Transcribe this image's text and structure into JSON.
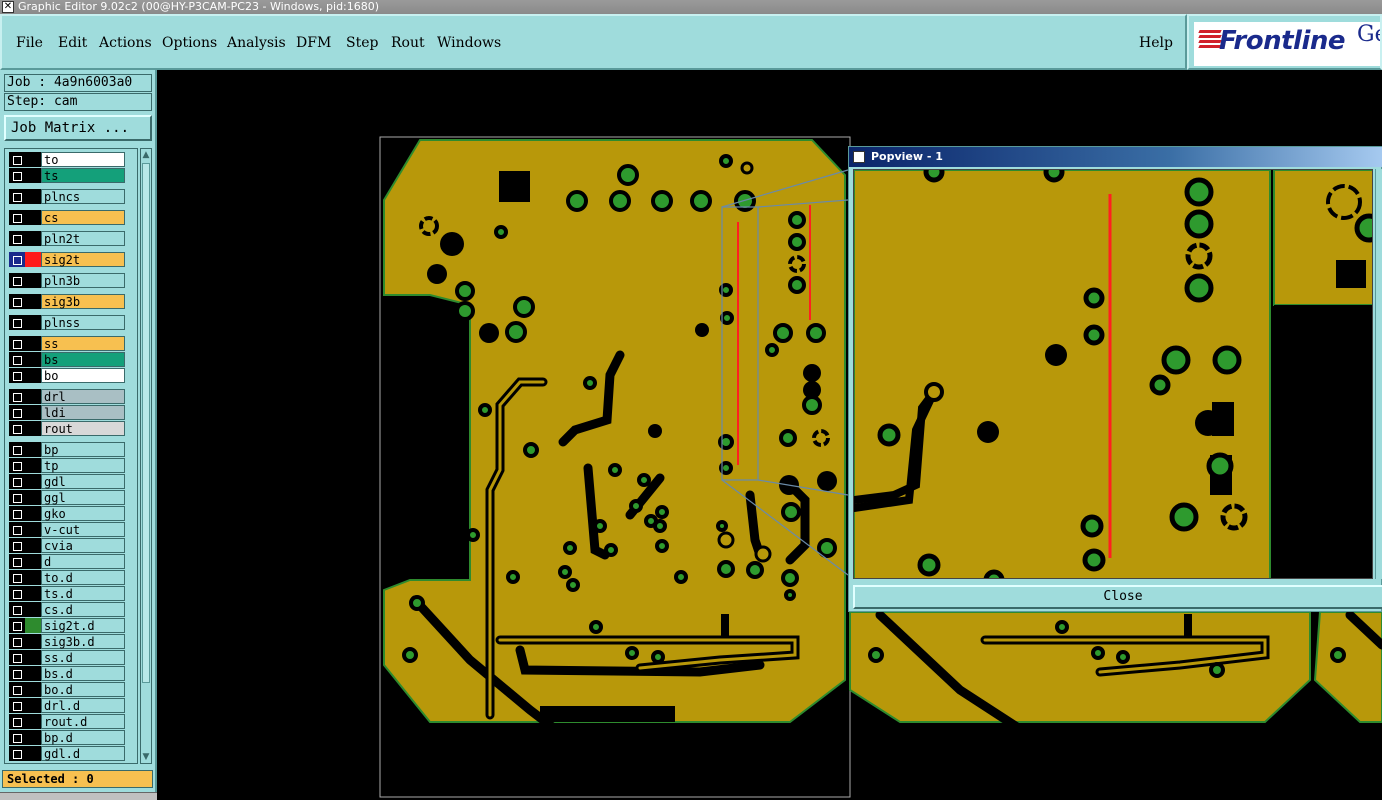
{
  "window": {
    "title": "Graphic Editor 9.02c2 (00@HY-P3CAM-PC23 - Windows, pid:1680)"
  },
  "menu": {
    "items": [
      "File",
      "Edit",
      "Actions",
      "Options",
      "Analysis",
      "DFM",
      "Step",
      "Rout",
      "Windows"
    ],
    "help": "Help"
  },
  "logo": {
    "word": "Frontline",
    "word2": "Ge"
  },
  "panel": {
    "job": "Job : 4a9n6003a0",
    "step": "Step: cam",
    "job_matrix": "Job Matrix ...",
    "selected": "Selected : 0"
  },
  "layers": [
    {
      "name": "to",
      "bg": "#ffffff",
      "swatch": "#000000"
    },
    {
      "name": "ts",
      "bg": "#14a07a",
      "swatch": "#000000"
    },
    {
      "name": "plncs",
      "bg": "#9fdcdc",
      "swatch": "#000000"
    },
    {
      "name": "cs",
      "bg": "#f7c050",
      "swatch": "#000000"
    },
    {
      "name": "pln2t",
      "bg": "#9fdcdc",
      "swatch": "#000000"
    },
    {
      "name": "sig2t",
      "bg": "#f7c050",
      "swatch": "#ff1a1a",
      "active": true
    },
    {
      "name": "pln3b",
      "bg": "#9fdcdc",
      "swatch": "#000000"
    },
    {
      "name": "sig3b",
      "bg": "#f7c050",
      "swatch": "#000000"
    },
    {
      "name": "plnss",
      "bg": "#9fdcdc",
      "swatch": "#000000"
    },
    {
      "name": "ss",
      "bg": "#f7c050",
      "swatch": "#000000"
    },
    {
      "name": "bs",
      "bg": "#14a07a",
      "swatch": "#000000"
    },
    {
      "name": "bo",
      "bg": "#ffffff",
      "swatch": "#000000"
    },
    {
      "name": "drl",
      "bg": "#a9bfc4",
      "swatch": "#000000"
    },
    {
      "name": "ldi",
      "bg": "#a9bfc4",
      "swatch": "#000000"
    },
    {
      "name": "rout",
      "bg": "#d8d8d8",
      "swatch": "#000000"
    },
    {
      "name": "bp",
      "bg": "#9fdcdc",
      "swatch": "#000000"
    },
    {
      "name": "tp",
      "bg": "#9fdcdc",
      "swatch": "#000000"
    },
    {
      "name": "gdl",
      "bg": "#9fdcdc",
      "swatch": "#000000"
    },
    {
      "name": "ggl",
      "bg": "#9fdcdc",
      "swatch": "#000000"
    },
    {
      "name": "gko",
      "bg": "#9fdcdc",
      "swatch": "#000000"
    },
    {
      "name": "v-cut",
      "bg": "#9fdcdc",
      "swatch": "#000000"
    },
    {
      "name": "cvia",
      "bg": "#9fdcdc",
      "swatch": "#000000"
    },
    {
      "name": "d",
      "bg": "#9fdcdc",
      "swatch": "#000000"
    },
    {
      "name": "to.d",
      "bg": "#9fdcdc",
      "swatch": "#000000"
    },
    {
      "name": "ts.d",
      "bg": "#9fdcdc",
      "swatch": "#000000"
    },
    {
      "name": "cs.d",
      "bg": "#9fdcdc",
      "swatch": "#000000"
    },
    {
      "name": "sig2t.d",
      "bg": "#9fdcdc",
      "swatch": "#2e8b2e"
    },
    {
      "name": "sig3b.d",
      "bg": "#9fdcdc",
      "swatch": "#000000"
    },
    {
      "name": "ss.d",
      "bg": "#9fdcdc",
      "swatch": "#000000"
    },
    {
      "name": "bs.d",
      "bg": "#9fdcdc",
      "swatch": "#000000"
    },
    {
      "name": "bo.d",
      "bg": "#9fdcdc",
      "swatch": "#000000"
    },
    {
      "name": "drl.d",
      "bg": "#9fdcdc",
      "swatch": "#000000"
    },
    {
      "name": "rout.d",
      "bg": "#9fdcdc",
      "swatch": "#000000"
    },
    {
      "name": "bp.d",
      "bg": "#9fdcdc",
      "swatch": "#000000"
    },
    {
      "name": "gdl.d",
      "bg": "#9fdcdc",
      "swatch": "#000000"
    }
  ],
  "popview": {
    "title": "Popview - 1",
    "close": "Close"
  },
  "colors": {
    "copper": "#b8980a",
    "pad": "#2e9a2e",
    "trace_red": "#ff2020",
    "outline": "#2e8b2e"
  }
}
